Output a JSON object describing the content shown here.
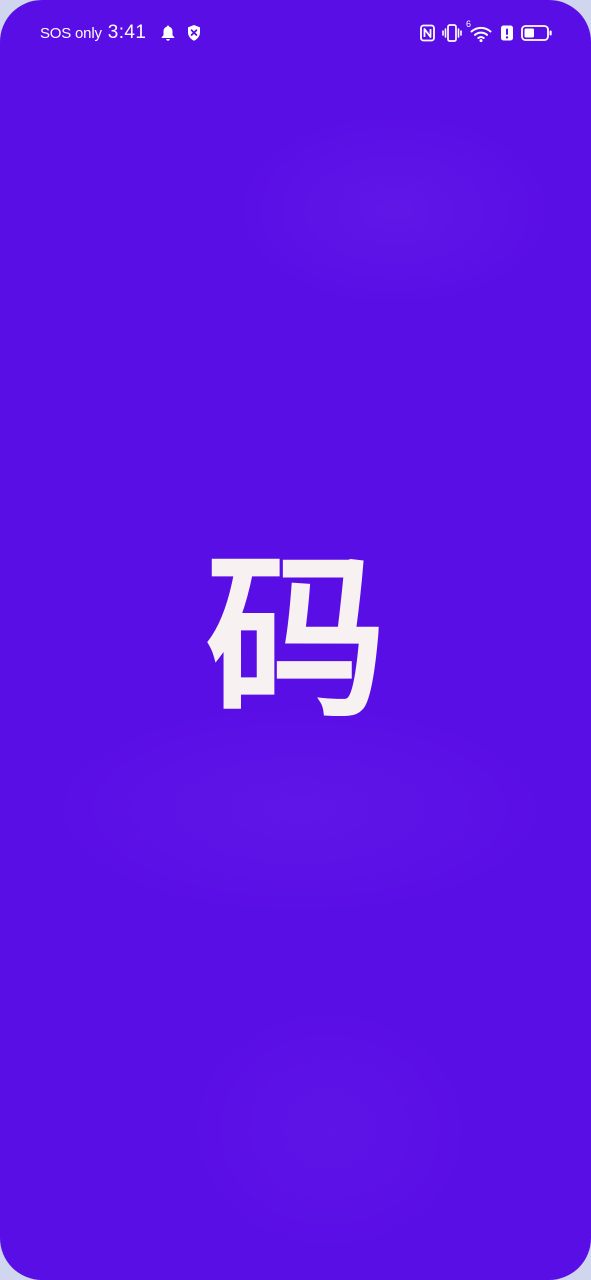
{
  "status_bar": {
    "carrier": "SOS only",
    "time": "3:41",
    "icons": [
      "bell-icon",
      "shield-icon",
      "nfc-icon",
      "vibrate-icon",
      "wifi-icon",
      "alert-icon",
      "battery-icon"
    ],
    "wifi_badge": "6",
    "battery_level": 0.45
  },
  "splash": {
    "logo_text": "码"
  },
  "colors": {
    "background": "#5a0ee6",
    "logo": "#f8f1f2",
    "status_text": "#ffffff"
  }
}
